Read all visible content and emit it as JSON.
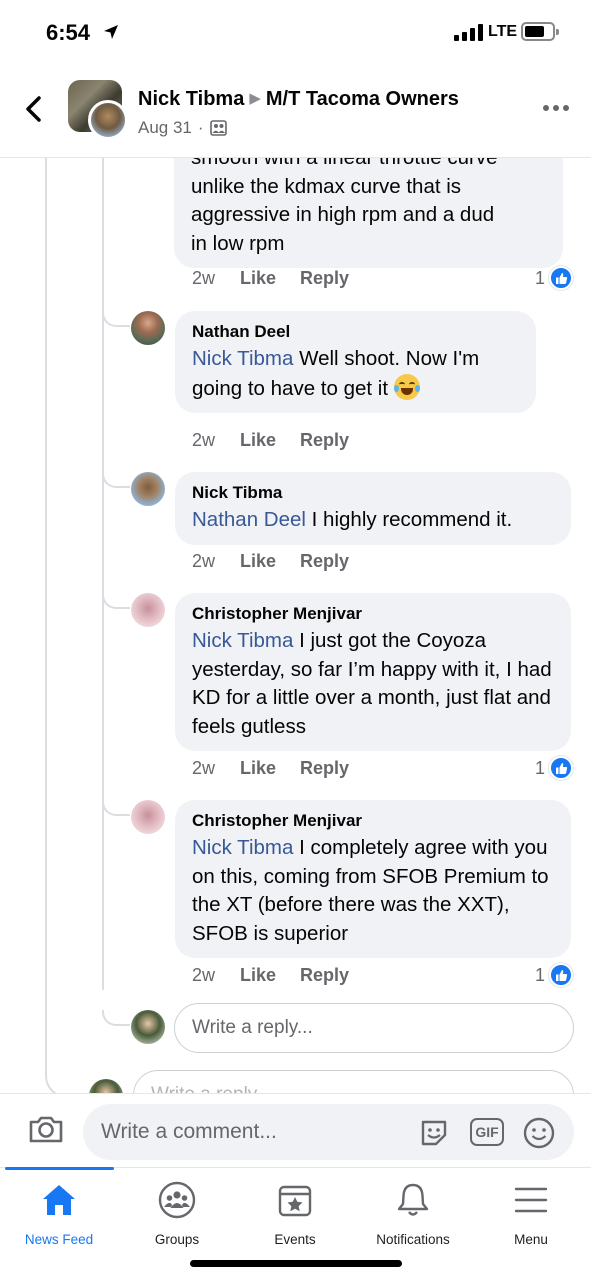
{
  "status_bar": {
    "time": "6:54",
    "network": "LTE"
  },
  "header": {
    "author": "Nick Tibma",
    "group": "M/T Tacoma Owners",
    "date": "Aug 31",
    "separator": "·"
  },
  "partial_comment": {
    "lines": [
      "smooth with a linear throttle curve",
      "unlike the kdmax curve that is",
      "aggressive in high rpm and a dud",
      "in low rpm"
    ],
    "age": "2w",
    "like": "Like",
    "reply": "Reply",
    "reactions": "1"
  },
  "replies": [
    {
      "name": "Nathan Deel",
      "mention": "Nick Tibma",
      "text": " Well shoot. Now I'm going to have to get it ",
      "emoji": "face-with-tears-of-joy",
      "age": "2w",
      "like": "Like",
      "reply": "Reply",
      "reactions": ""
    },
    {
      "name": "Nick Tibma",
      "mention": "Nathan Deel",
      "text": " I highly recommend it.",
      "age": "2w",
      "like": "Like",
      "reply": "Reply",
      "reactions": ""
    },
    {
      "name": "Christopher Menjivar",
      "mention": "Nick Tibma",
      "text": " I just got the Coyoza yesterday, so far I’m happy with it, I had KD for a little over a month, just flat and feels gutless",
      "age": "2w",
      "like": "Like",
      "reply": "Reply",
      "reactions": "1"
    },
    {
      "name": "Christopher Menjivar",
      "mention": "Nick Tibma",
      "text": " I completely agree with you on this, coming from SFOB Premium to the XT (before there was the XXT), SFOB is superior",
      "age": "2w",
      "like": "Like",
      "reply": "Reply",
      "reactions": "1"
    }
  ],
  "reply_input": {
    "placeholder": "Write a reply..."
  },
  "reply_input_partial": {
    "placeholder": "Write a reply..."
  },
  "composer": {
    "placeholder": "Write a comment...",
    "gif_label": "GIF"
  },
  "tabs": [
    {
      "label": "News Feed",
      "icon": "home-icon",
      "active": true
    },
    {
      "label": "Groups",
      "icon": "groups-icon",
      "active": false
    },
    {
      "label": "Events",
      "icon": "events-icon",
      "active": false
    },
    {
      "label": "Notifications",
      "icon": "bell-icon",
      "active": false
    },
    {
      "label": "Menu",
      "icon": "menu-icon",
      "active": false
    }
  ],
  "colors": {
    "accent": "#1877f2",
    "mention": "#385898",
    "bubble": "#f0f2f5",
    "muted": "#65676b"
  }
}
